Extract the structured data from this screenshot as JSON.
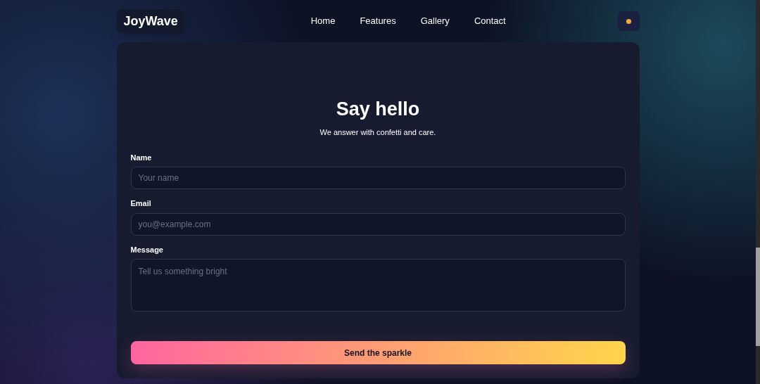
{
  "brand": "JoyWave",
  "nav": [
    {
      "label": "Home"
    },
    {
      "label": "Features"
    },
    {
      "label": "Gallery"
    },
    {
      "label": "Contact"
    }
  ],
  "title": "Say hello",
  "subtitle": "We answer with confetti and care.",
  "fields": [
    {
      "kind": "input",
      "label": "Name",
      "placeholder": "Your name"
    },
    {
      "kind": "input",
      "label": "Email",
      "placeholder": "you@example.com"
    },
    {
      "kind": "textarea",
      "label": "Message",
      "placeholder": "Tell us something bright"
    }
  ],
  "submit": "Send the sparkle"
}
